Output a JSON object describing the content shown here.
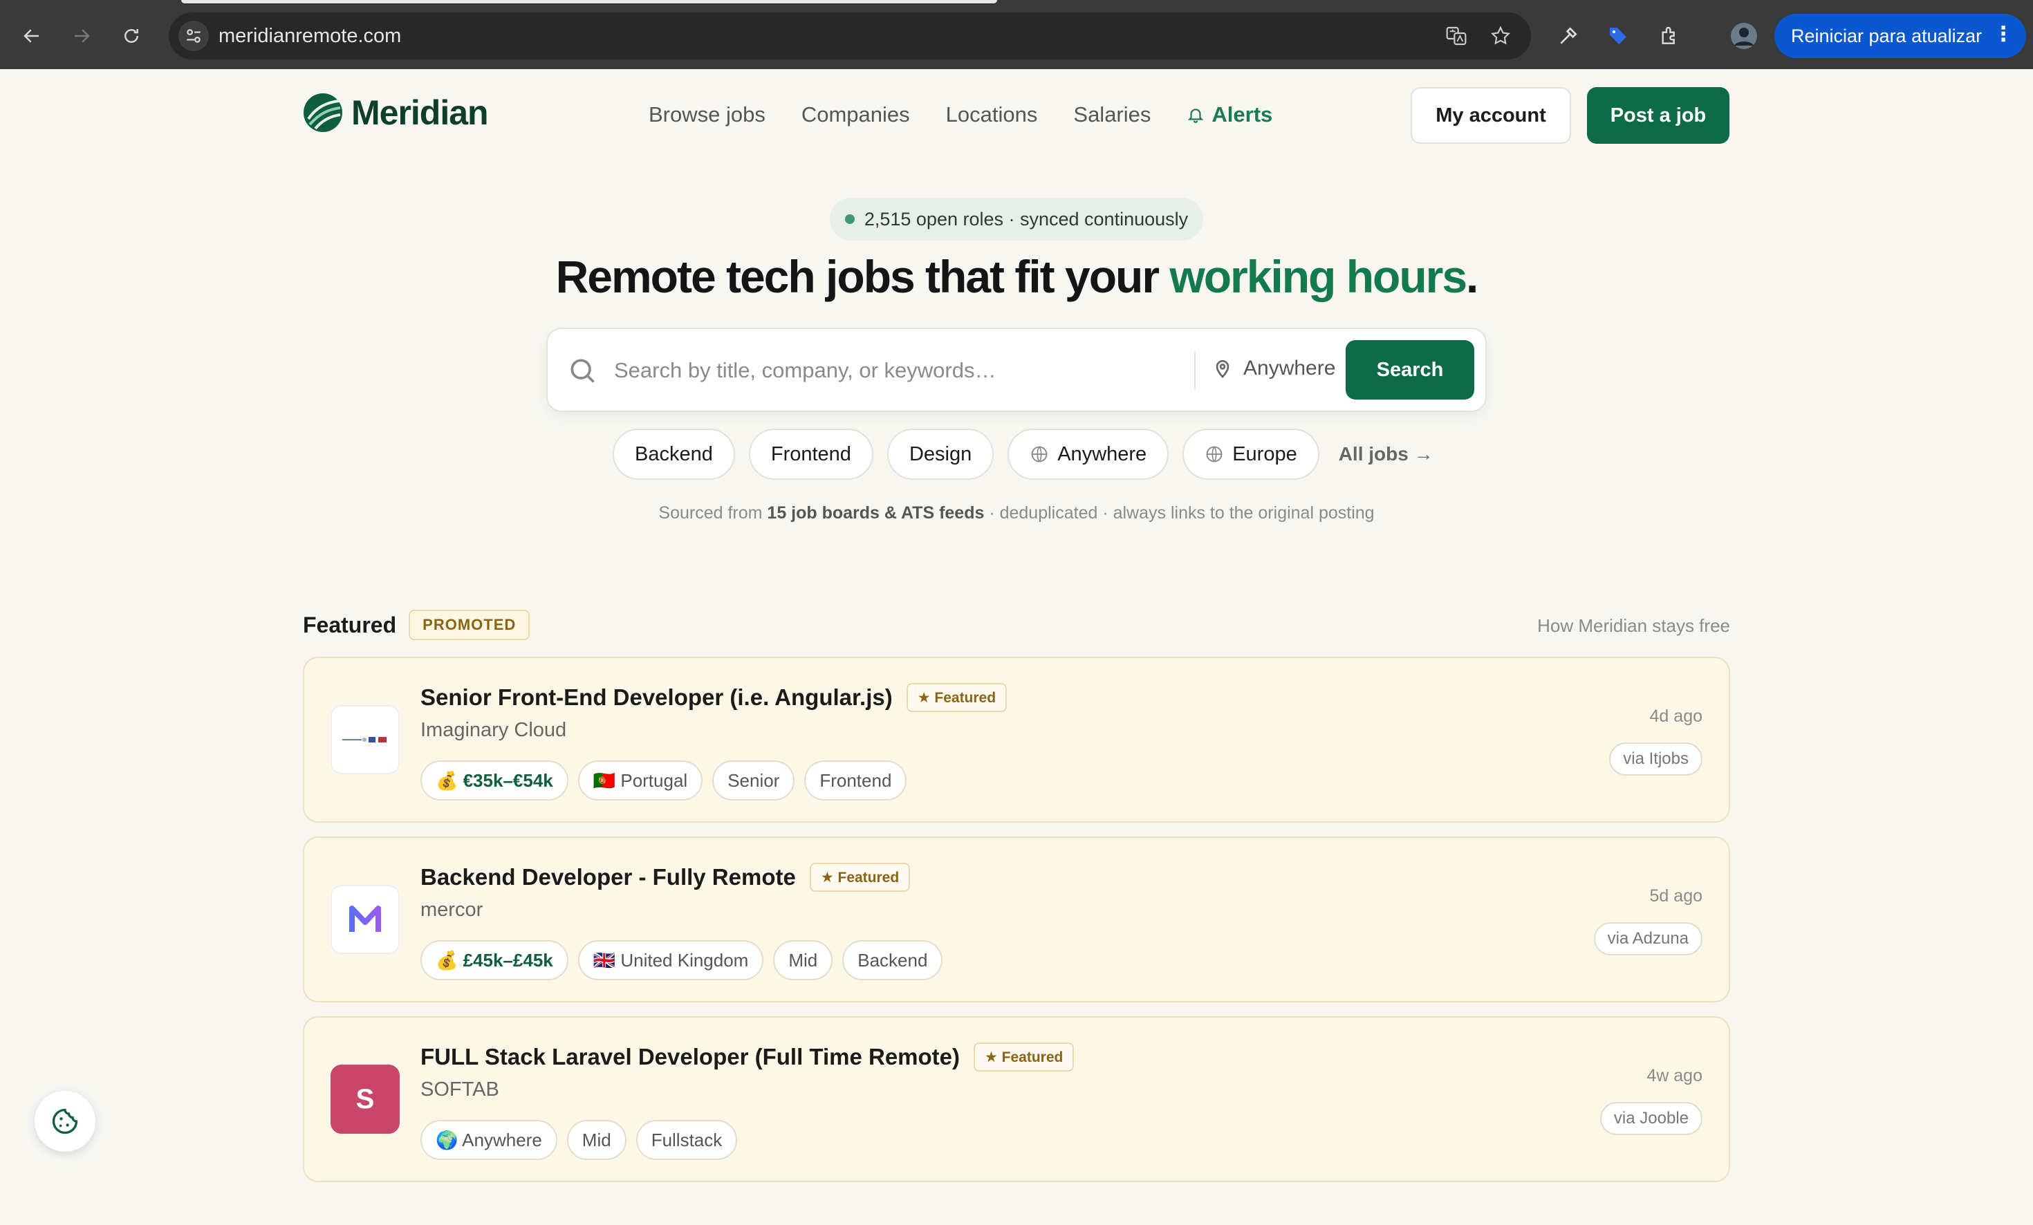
{
  "browser": {
    "url": "meridianremote.com",
    "update_label": "Reiniciar para atualizar",
    "more_glyph": "⋮"
  },
  "brand": {
    "name": "Meridian",
    "accent": "#0e6b47"
  },
  "nav": {
    "items": [
      "Browse jobs",
      "Companies",
      "Locations",
      "Salaries"
    ],
    "alerts_label": "Alerts",
    "account_label": "My account",
    "post_label": "Post a job"
  },
  "hero": {
    "status": "2,515 open roles · synced continuously",
    "title_pre": "Remote tech jobs that fit your ",
    "title_accent": "working hours",
    "title_post": "."
  },
  "search": {
    "placeholder": "Search by title, company, or keywords…",
    "location": "Anywhere",
    "button": "Search"
  },
  "chips": {
    "items": [
      {
        "label": "Backend",
        "icon": ""
      },
      {
        "label": "Frontend",
        "icon": ""
      },
      {
        "label": "Design",
        "icon": ""
      },
      {
        "label": "Anywhere",
        "icon": "globe-icon"
      },
      {
        "label": "Europe",
        "icon": "globe-icon"
      }
    ],
    "all_jobs": "All jobs →"
  },
  "sources": {
    "pre": "Sourced from ",
    "bold": "15 job boards & ATS feeds",
    "post": " · deduplicated · always links to the original posting"
  },
  "featured": {
    "title": "Featured",
    "promoted": "PROMOTED",
    "how_free": "How Meridian stays free",
    "badge": "★ Featured",
    "jobs": [
      {
        "title": "Senior Front-End Developer (i.e. Angular.js)",
        "company": "Imaginary Cloud",
        "tags": [
          "💰 €35k–€54k",
          "🇵🇹 Portugal",
          "Senior",
          "Frontend"
        ],
        "age": "4d ago",
        "via": "via Itjobs",
        "logo_letter": "",
        "logo_color": "#ffffff"
      },
      {
        "title": "Backend Developer - Fully Remote",
        "company": "mercor",
        "tags": [
          "💰 £45k–£45k",
          "🇬🇧 United Kingdom",
          "Mid",
          "Backend"
        ],
        "age": "5d ago",
        "via": "via Adzuna",
        "logo_letter": "M",
        "logo_color": "#7a5cf0"
      },
      {
        "title": "FULL Stack Laravel Developer (Full Time Remote)",
        "company": "SOFTAB",
        "tags": [
          "🌍 Anywhere",
          "Mid",
          "Fullstack"
        ],
        "age": "4w ago",
        "via": "via Jooble",
        "logo_letter": "S",
        "logo_color": "#c9466a"
      }
    ]
  }
}
